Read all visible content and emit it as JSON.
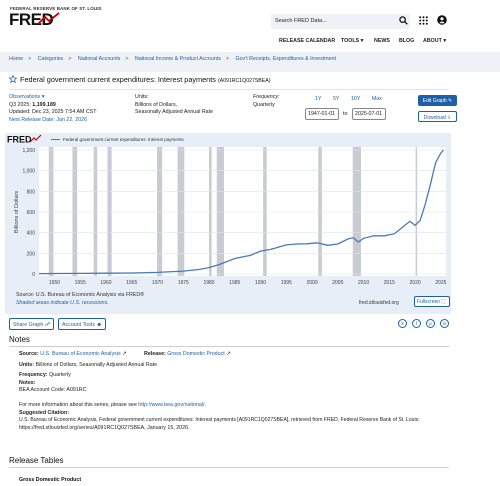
{
  "header": {
    "logo_sub": "FEDERAL RESERVE BANK OF ST. LOUIS",
    "logo": "FRED",
    "search_placeholder": "Search FRED Data..."
  },
  "nav": [
    "RELEASE CALENDAR",
    "TOOLS",
    "NEWS",
    "BLOG",
    "ABOUT"
  ],
  "breadcrumb": [
    "Home",
    "Categories",
    "National Accounts",
    "National Income & Product Accounts",
    "Gov't Receipts, Expenditures & Investment"
  ],
  "series": {
    "title": "Federal government current expenditures: Interest payments",
    "code": "(A091RC1Q027SBEA)",
    "observations_label": "Observations",
    "latest_label": "Q3 2025:",
    "latest_value": "1,199.189",
    "updated": "Updated: Dec 23, 2025 7:54 AM CST",
    "next_release": "Next Release Date: Jan 22, 2026",
    "units_label": "Units:",
    "units_line1": "Billions of Dollars,",
    "units_line2": "Seasonally Adjusted Annual Rate",
    "freq_label": "Frequency:",
    "freq_value": "Quarterly",
    "ranges": [
      "1Y",
      "5Y",
      "10Y",
      "Max"
    ],
    "date_from": "1947-01-01",
    "date_to_sep": "to",
    "date_to": "2025-07-01",
    "edit_graph": "Edit Graph",
    "download": "Download"
  },
  "chart_data": {
    "type": "line",
    "title": "",
    "legend": "Federal government current expenditures: Interest payments",
    "ylabel": "Billions of Dollars",
    "xlabel": "",
    "ylim": [
      0,
      1200
    ],
    "yticks": [
      0,
      200,
      400,
      600,
      800,
      1000,
      1200
    ],
    "ytick_labels": [
      "0",
      "200",
      "400",
      "600",
      "800",
      "1,000",
      "1,200"
    ],
    "xlim": [
      1947,
      2026
    ],
    "xticks": [
      1950,
      1955,
      1960,
      1965,
      1970,
      1975,
      1980,
      1985,
      1990,
      1995,
      2000,
      2005,
      2010,
      2015,
      2020,
      2025
    ],
    "recessions": [
      [
        1948.9,
        1949.8
      ],
      [
        1953.5,
        1954.4
      ],
      [
        1957.6,
        1958.3
      ],
      [
        1960.3,
        1961.1
      ],
      [
        1969.9,
        1970.9
      ],
      [
        1973.9,
        1975.2
      ],
      [
        1980.0,
        1980.5
      ],
      [
        1981.5,
        1982.9
      ],
      [
        1990.5,
        1991.2
      ],
      [
        2001.2,
        2001.9
      ],
      [
        2007.9,
        2009.5
      ],
      [
        2020.1,
        2020.4
      ]
    ],
    "series": [
      {
        "x": [
          1947,
          1950,
          1955,
          1960,
          1965,
          1970,
          1975,
          1978,
          1980,
          1982,
          1985,
          1988,
          1990,
          1992,
          1995,
          1997,
          1999,
          2001,
          2003,
          2005,
          2007,
          2008,
          2009,
          2010,
          2012,
          2014,
          2016,
          2018,
          2019,
          2020,
          2021,
          2022,
          2023,
          2024,
          2025,
          2025.5
        ],
        "y": [
          4,
          5,
          6,
          8,
          10,
          15,
          28,
          44,
          62,
          92,
          150,
          180,
          222,
          238,
          282,
          290,
          292,
          302,
          278,
          290,
          340,
          350,
          310,
          345,
          370,
          370,
          390,
          470,
          510,
          470,
          520,
          680,
          870,
          1080,
          1170,
          1199
        ]
      }
    ],
    "grid": true
  },
  "chart_footer": {
    "source": "Source: U.S. Bureau of Economic Analysis via FRED®",
    "shaded": "Shaded areas indicate U.S. recessions.",
    "site": "fred.stlouisfed.org",
    "fullscreen": "Fullscreen"
  },
  "actions": {
    "share": "Share Graph",
    "account_tools": "Account Tools"
  },
  "notes": {
    "heading": "Notes",
    "source_label": "Source:",
    "source_value": "U.S. Bureau of Economic Analysis",
    "release_label": "Release:",
    "release_value": "Gross Domestic Product",
    "units_label": "Units:",
    "units_value": "Billions of Dollars, Seasonally Adjusted Annual Rate",
    "freq_label": "Frequency:",
    "freq_value": "Quarterly",
    "notes_label": "Notes:",
    "account_code": "BEA Account Code: A091RC",
    "more_info": "For more information about this series, please see",
    "more_info_link": "http://www.bea.gov/national/",
    "citation_label": "Suggested Citation:",
    "citation_line1": "U.S. Bureau of Economic Analysis, Federal government current expenditures: Interest payments [A091RC1Q027SBEA], retrieved from FRED, Federal Reserve Bank of St. Louis;",
    "citation_line2": "https://fred.stlouisfed.org/series/A091RC1Q027SBEA, January 15, 2026."
  },
  "release_tables": {
    "heading": "Release Tables",
    "first": "Gross Domestic Product"
  },
  "colors": {
    "accent": "#1f5fa8",
    "line": "#4a7ab7",
    "chart_bg": "#e7eef7",
    "recession": "#c8ccd2"
  }
}
